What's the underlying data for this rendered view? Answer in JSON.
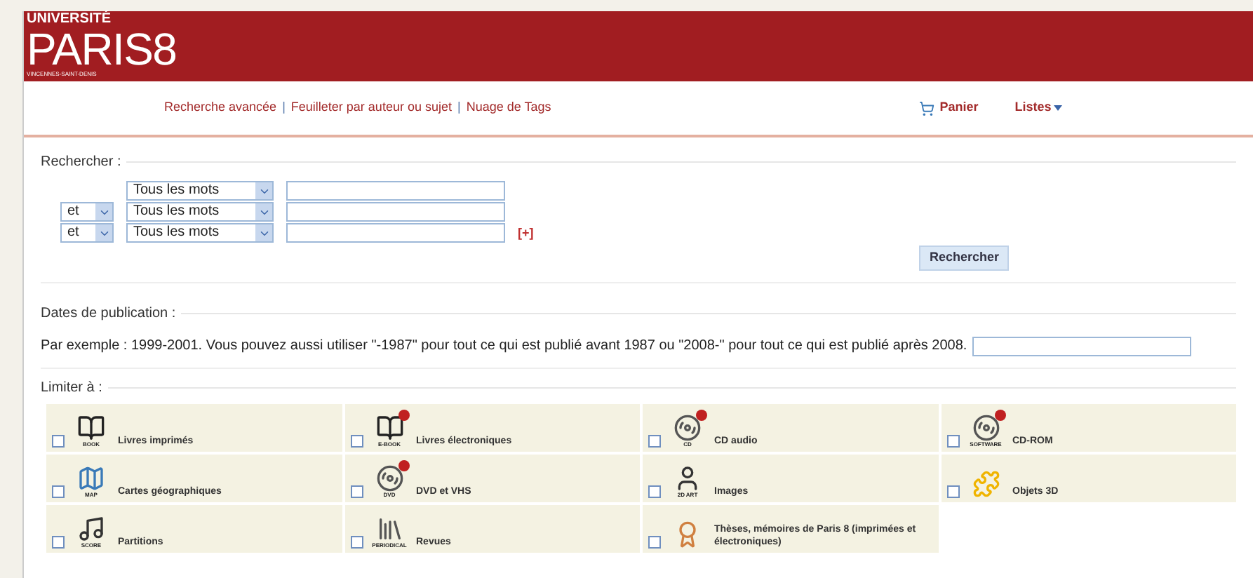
{
  "header": {
    "logo_top": "UNIVERSITÉ",
    "logo_main": "PARIS8",
    "logo_sub": "VINCENNES-SAINT-DENIS"
  },
  "nav": {
    "links": [
      "Recherche avancée",
      "Feuilleter par auteur ou sujet",
      "Nuage de Tags"
    ],
    "separator": "|",
    "cart": "Panier",
    "lists": "Listes"
  },
  "search": {
    "legend": "Rechercher :",
    "rows": [
      {
        "field": "Tous les mots",
        "value": ""
      },
      {
        "operator": "et",
        "field": "Tous les mots",
        "value": ""
      },
      {
        "operator": "et",
        "field": "Tous les mots",
        "value": "",
        "add": "[+]"
      }
    ],
    "button": "Rechercher"
  },
  "dates": {
    "legend": "Dates de publication :",
    "help": "Par exemple : 1999-2001. Vous pouvez aussi utiliser \"-1987\" pour tout ce qui est publié avant 1987 ou \"2008-\" pour tout ce qui est publié après 2008."
  },
  "limit": {
    "legend": "Limiter à :",
    "items": [
      {
        "kind": "book",
        "caption": "BOOK",
        "label": "Livres imprimés",
        "checked": false
      },
      {
        "kind": "ebook",
        "caption": "E-BOOK",
        "label": "Livres électroniques",
        "checked": false
      },
      {
        "kind": "cd",
        "caption": "CD",
        "label": "CD audio",
        "checked": false
      },
      {
        "kind": "software",
        "caption": "SOFTWARE",
        "label": "CD-ROM",
        "checked": false
      },
      {
        "kind": "map",
        "caption": "MAP",
        "label": "Cartes géographiques",
        "checked": false
      },
      {
        "kind": "dvd",
        "caption": "DVD",
        "label": "DVD et VHS",
        "checked": false
      },
      {
        "kind": "art",
        "caption": "2D ART",
        "label": "Images",
        "checked": false
      },
      {
        "kind": "object",
        "label": "Objets 3D",
        "checked": false
      },
      {
        "kind": "score",
        "caption": "SCORE",
        "label": "Partitions",
        "checked": false
      },
      {
        "kind": "periodical",
        "caption": "PERIODICAL",
        "label": "Revues",
        "checked": false
      },
      {
        "kind": "thesis",
        "label": "Thèses, mémoires de Paris 8 (imprimées et électroniques)",
        "checked": false
      }
    ]
  }
}
